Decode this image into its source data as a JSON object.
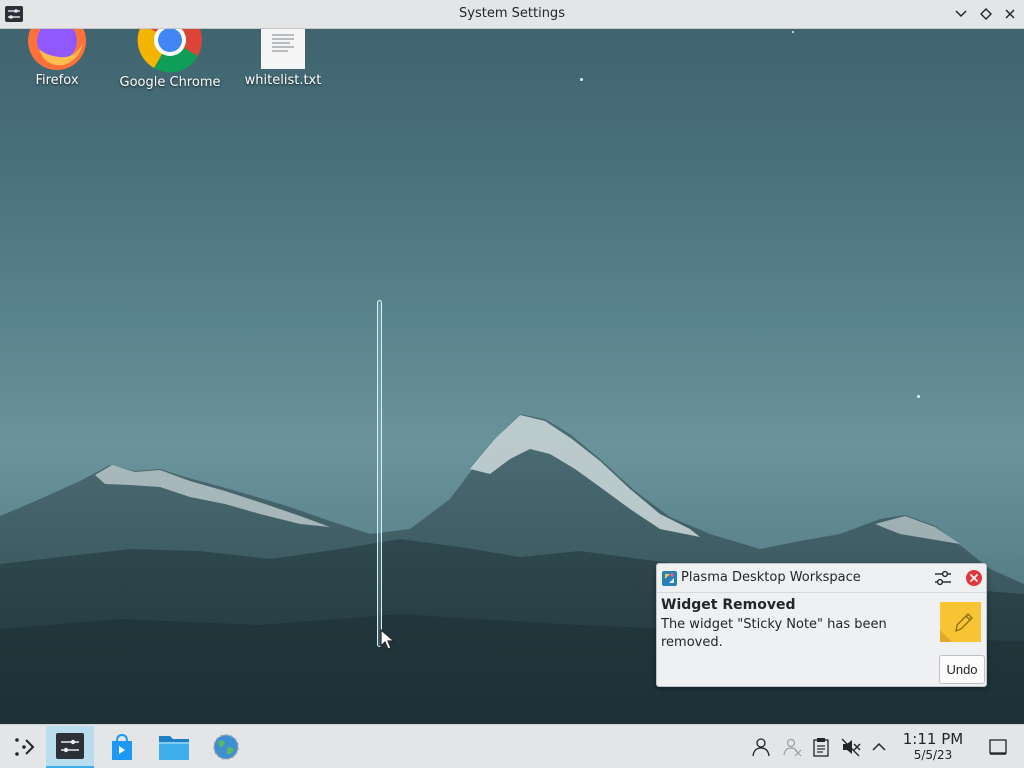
{
  "window": {
    "title": "System Settings",
    "icon": "settings-sliders-icon"
  },
  "desktop": {
    "icons": [
      {
        "label": "Firefox",
        "icon": "firefox-icon"
      },
      {
        "label": "Google Chrome",
        "icon": "chrome-icon"
      },
      {
        "label": "whitelist.txt",
        "icon": "text-file-icon"
      }
    ]
  },
  "notification": {
    "app_name": "Plasma Desktop Workspace",
    "title": "Widget Removed",
    "body": "The widget \"Sticky Note\" has been removed.",
    "action_label": "Undo",
    "image_icon": "sticky-note-icon"
  },
  "taskbar": {
    "launchers": [
      "app-launcher-icon",
      "system-settings-icon",
      "discover-store-icon",
      "dolphin-folder-icon",
      "browser-globe-icon"
    ],
    "tray": [
      "user-icon",
      "kde-connect-icon",
      "clipboard-icon",
      "volume-muted-icon",
      "show-hidden-chevron-icon"
    ],
    "clock": {
      "time": "1:11 PM",
      "date": "5/5/23"
    }
  },
  "colors": {
    "accent": "#3daee9",
    "panel": "#e3e5e7",
    "close_red": "#e0373b"
  }
}
